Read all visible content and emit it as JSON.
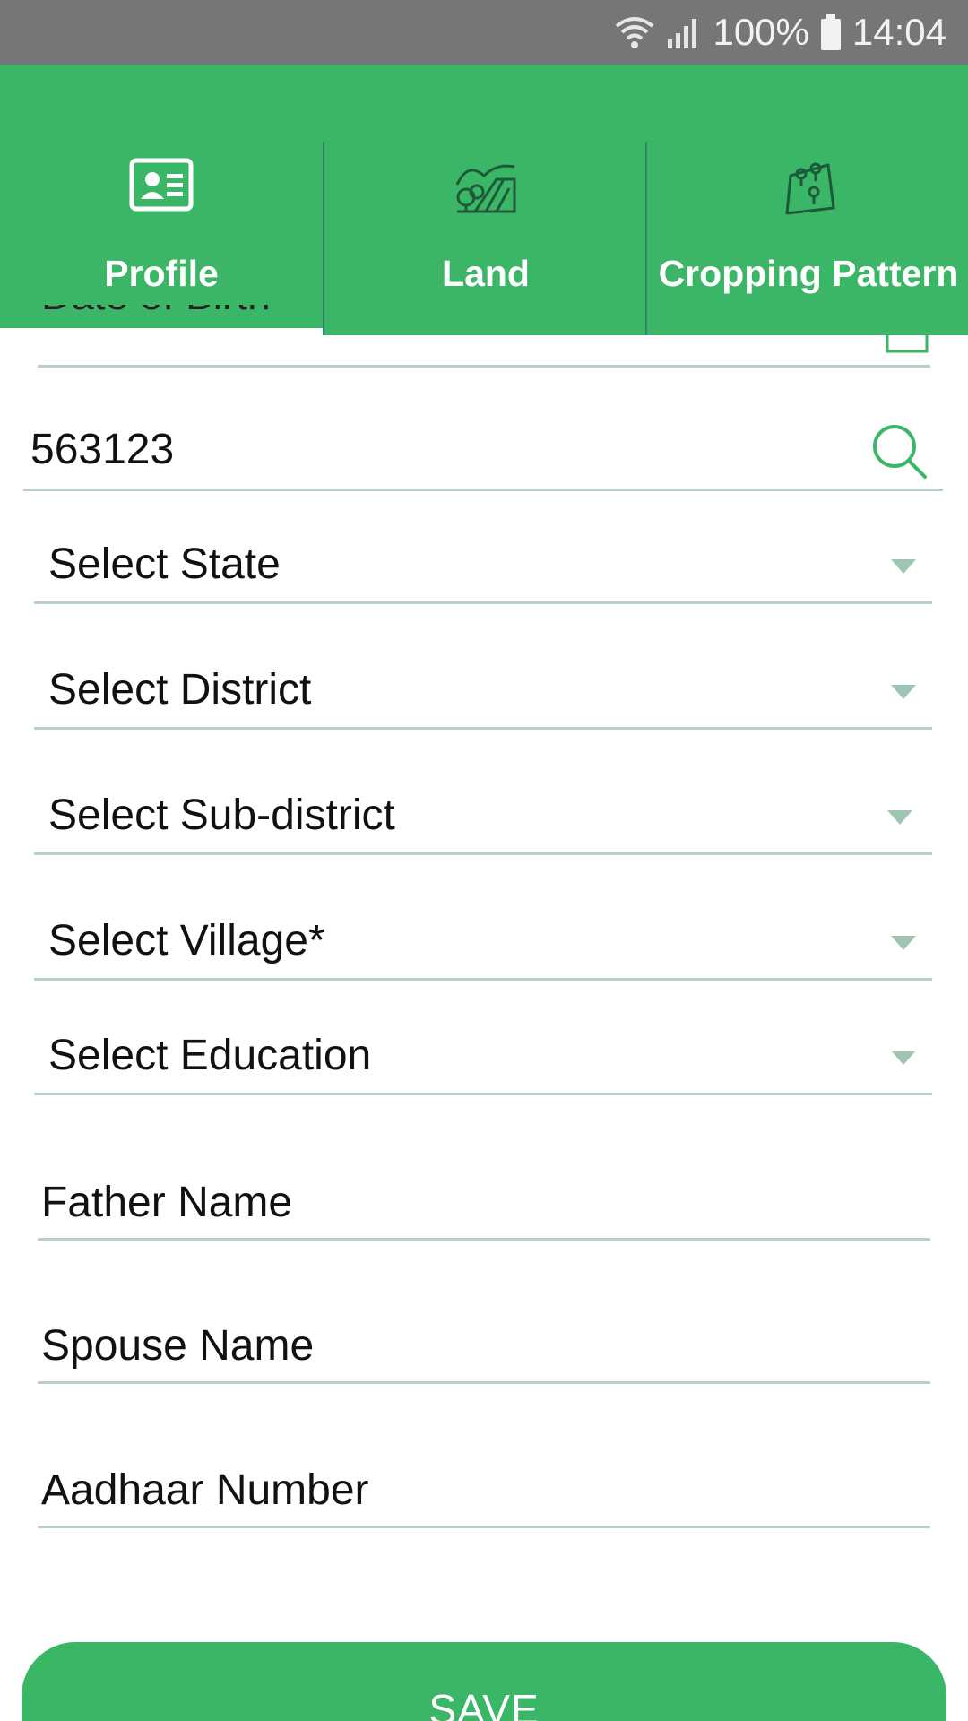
{
  "status_bar": {
    "battery": "100%",
    "time": "14:04",
    "icons": [
      "wifi-icon",
      "signal-icon",
      "battery-icon"
    ]
  },
  "tabs": [
    {
      "label": "Profile",
      "icon": "profile-card-icon",
      "selected": true
    },
    {
      "label": "Land",
      "icon": "land-field-icon",
      "selected": false
    },
    {
      "label": "Cropping Pattern",
      "icon": "map-pins-icon",
      "selected": false
    }
  ],
  "form": {
    "dob_label": "Date of Birth",
    "pincode_value": "563123",
    "dropdowns": [
      {
        "label": "Select State"
      },
      {
        "label": "Select District"
      },
      {
        "label": "Select Sub-district"
      },
      {
        "label": "Select Village*"
      },
      {
        "label": "Select Education"
      }
    ],
    "father_name_placeholder": "Father Name",
    "spouse_name_placeholder": "Spouse Name",
    "aadhaar_placeholder": "Aadhaar Number"
  },
  "save_label": "SAVE",
  "colors": {
    "accent": "#3bb566",
    "status_bar": "#767676",
    "underline": "#b9d1c5"
  }
}
